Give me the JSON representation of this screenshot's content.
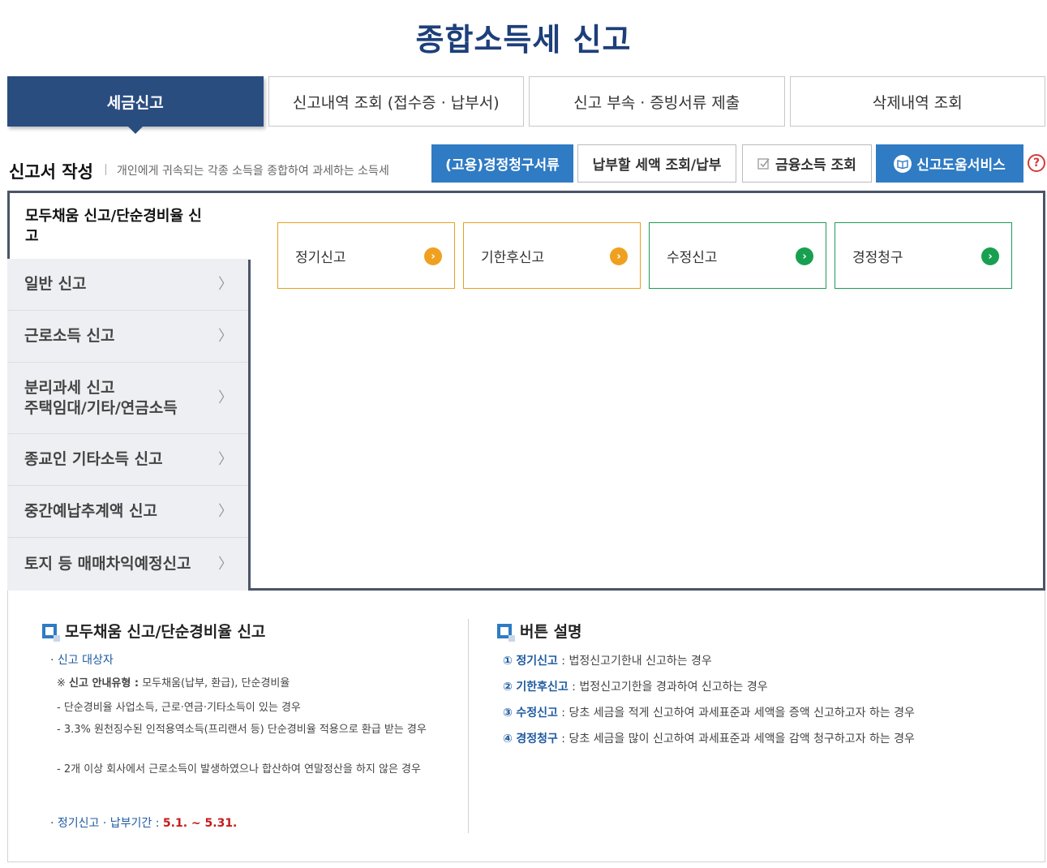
{
  "page_title": "종합소득세  신고",
  "tabs": [
    {
      "label": "세금신고"
    },
    {
      "label": "신고내역 조회 (접수증 · 납부서)"
    },
    {
      "label": "신고 부속 · 증빙서류 제출"
    },
    {
      "label": "삭제내역 조회"
    }
  ],
  "section": {
    "title": "신고서 작성",
    "desc": "개인에게 귀속되는 각종 소득을 종합하여 과세하는 소득세"
  },
  "actions": {
    "employment_claim": "(고용)경정청구서류",
    "tax_payment": "납부할 세액 조회/납부",
    "financial_income": "금융소득 조회",
    "help_service": "신고도움서비스",
    "help_icon": "?"
  },
  "sidebar": {
    "active": "모두채움 신고/단순경비율 신고",
    "items": [
      {
        "label": "일반 신고"
      },
      {
        "label": "근로소득 신고"
      },
      {
        "label": "분리과세 신고\n주택임대/기타/연금소득"
      },
      {
        "label": "종교인 기타소득 신고"
      },
      {
        "label": "중간예납추계액 신고"
      },
      {
        "label": "토지 등 매매차익예정신고"
      }
    ]
  },
  "cards": [
    {
      "label": "정기신고",
      "color": "#f0a020"
    },
    {
      "label": "기한후신고",
      "color": "#f0a020"
    },
    {
      "label": "수정신고",
      "color": "#18a050"
    },
    {
      "label": "경정청구",
      "color": "#18a050"
    }
  ],
  "info_left": {
    "title": "모두채움 신고/단순경비율 신고",
    "target_label": "신고 대상자",
    "guide_prefix": "※",
    "guide_label": "신고 안내유형 :",
    "guide_value": "모두채움(납부, 환급), 단순경비율",
    "bullets": [
      "단순경비율 사업소득, 근로·연금·기타소득이 있는 경우",
      "3.3% 원천징수된 인적용역소득(프리랜서 등) 단순경비율 적용으로 환급 받는 경우",
      "2개 이상 회사에서 근로소득이 발생하였으나 합산하여 연말정산을 하지 않은 경우"
    ],
    "period_label": "정기신고 · 납부기간 :",
    "period_value": "5.1. ~ 5.31."
  },
  "info_right": {
    "title": "버튼 설명",
    "items": [
      {
        "num": "①",
        "name": "정기신고",
        "desc": " : 법정신고기한내 신고하는 경우"
      },
      {
        "num": "②",
        "name": "기한후신고",
        "desc": " : 법정신고기한을 경과하여 신고하는 경우"
      },
      {
        "num": "③",
        "name": "수정신고",
        "desc": " : 당초 세금을 적게 신고하여 과세표준과 세액을 증액 신고하고자 하는 경우"
      },
      {
        "num": "④",
        "name": "경정청구",
        "desc": " : 당초 세금을 많이 신고하여 과세표준과 세액을 감액 청구하고자 하는 경우"
      }
    ]
  }
}
